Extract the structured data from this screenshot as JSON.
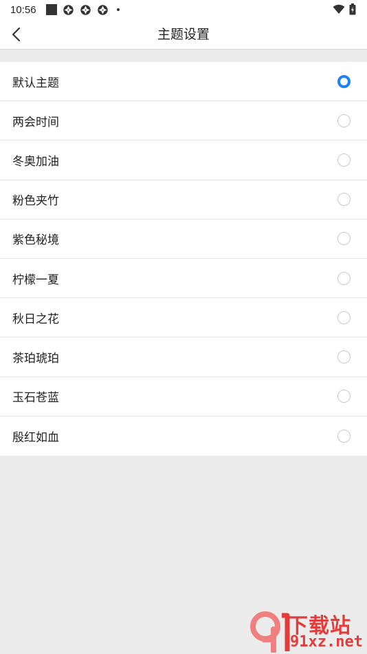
{
  "status_bar": {
    "time": "10:56",
    "icons": [
      "notification-square-icon",
      "aperture-icon",
      "aperture-icon",
      "aperture-icon",
      "dot-icon",
      "wifi-icon",
      "battery-icon"
    ]
  },
  "header": {
    "title": "主题设置",
    "back_icon": "chevron-left-icon"
  },
  "themes": [
    {
      "label": "默认主题",
      "selected": true
    },
    {
      "label": "两会时间",
      "selected": false
    },
    {
      "label": "冬奥加油",
      "selected": false
    },
    {
      "label": "粉色夹竹",
      "selected": false
    },
    {
      "label": "紫色秘境",
      "selected": false
    },
    {
      "label": "柠檬一夏",
      "selected": false
    },
    {
      "label": "秋日之花",
      "selected": false
    },
    {
      "label": "茶珀琥珀",
      "selected": false
    },
    {
      "label": "玉石苍蓝",
      "selected": false
    },
    {
      "label": "殷红如血",
      "selected": false
    }
  ],
  "watermark": {
    "top": "下载站",
    "bottom": "91xz.net"
  },
  "colors": {
    "accent": "#1e82f0",
    "watermark": "#e43b3b",
    "background": "#ececec"
  }
}
